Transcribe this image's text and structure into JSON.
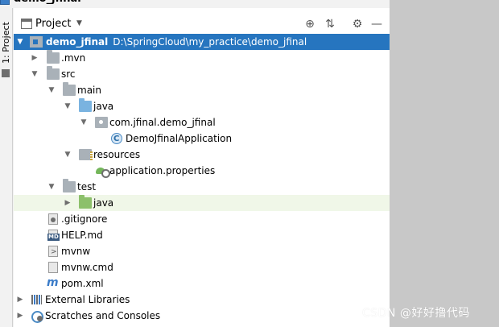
{
  "window": {
    "project_title": "demo_jfinal"
  },
  "side_tab": {
    "label": "1: Project"
  },
  "panel": {
    "title": "Project",
    "toolbar": {
      "locate_icon": "crosshair-icon",
      "collapse_icon": "collapse-all-icon",
      "settings_icon": "gear-icon",
      "hide_icon": "minimize-icon"
    }
  },
  "tree": {
    "root": {
      "name": "demo_jfinal",
      "path": "D:\\SpringCloud\\my_practice\\demo_jfinal"
    },
    "mvn": ".mvn",
    "src": "src",
    "main": "main",
    "java_main": "java",
    "package": "com.jfinal.demo_jfinal",
    "app_class": "DemoJfinalApplication",
    "resources": "resources",
    "app_props": "application.properties",
    "test": "test",
    "java_test": "java",
    "gitignore": ".gitignore",
    "help": "HELP.md",
    "mvnw": "mvnw",
    "mvnw_cmd": "mvnw.cmd",
    "pom": "pom.xml",
    "external_libs": "External Libraries",
    "scratches": "Scratches and Consoles"
  },
  "watermark": "CSDN @好好撸代码",
  "colors": {
    "selection": "#2675bf",
    "hover_row": "#f0f7e8",
    "right_area": "#c8c8c8"
  }
}
